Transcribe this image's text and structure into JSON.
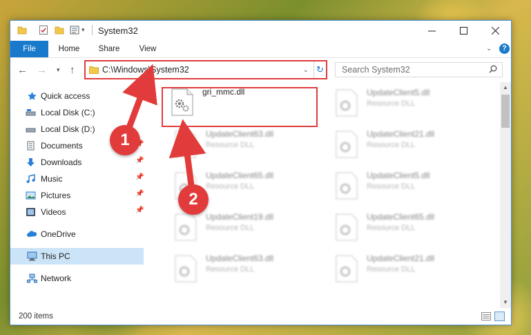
{
  "window": {
    "title": "System32"
  },
  "ribbon": {
    "tabs": [
      "File",
      "Home",
      "Share",
      "View"
    ],
    "help": "?"
  },
  "address_bar": {
    "path": "C:\\Windows\\System32"
  },
  "search": {
    "placeholder": "Search System32"
  },
  "sidebar": {
    "items": [
      {
        "label": "Quick access",
        "icon": "star-icon",
        "pinned": false
      },
      {
        "label": "Local Disk (C:)",
        "icon": "drive-icon",
        "pinned": false
      },
      {
        "label": "Local Disk (D:)",
        "icon": "drive-icon",
        "pinned": false
      },
      {
        "label": "Documents",
        "icon": "documents-icon",
        "pinned": true
      },
      {
        "label": "Downloads",
        "icon": "download-icon",
        "pinned": true
      },
      {
        "label": "Music",
        "icon": "music-icon",
        "pinned": true
      },
      {
        "label": "Pictures",
        "icon": "pictures-icon",
        "pinned": true
      },
      {
        "label": "Videos",
        "icon": "videos-icon",
        "pinned": true
      },
      {
        "label": "OneDrive",
        "icon": "onedrive-icon",
        "pinned": false
      },
      {
        "label": "This PC",
        "icon": "computer-icon",
        "selected": true
      },
      {
        "label": "Network",
        "icon": "network-icon",
        "pinned": false
      }
    ]
  },
  "files": {
    "highlighted": {
      "name": "gri_mmc.dll"
    },
    "left_column": [
      {
        "name": "UpdateClient63.dll",
        "type": "Resource DLL"
      },
      {
        "name": "UpdateClient65.dll",
        "type": "Resource DLL"
      },
      {
        "name": "UpdateClient19.dll",
        "type": "Resource DLL"
      },
      {
        "name": "UpdateClient63.dll",
        "type": "Resource DLL"
      }
    ],
    "right_column": [
      {
        "name": "UpdateClient5.dll",
        "type": "Resource DLL"
      },
      {
        "name": "UpdateClient21.dll",
        "type": "Resource DLL"
      },
      {
        "name": "UpdateClient5.dll",
        "type": "Resource DLL"
      },
      {
        "name": "UpdateClient65.dll",
        "type": "Resource DLL"
      },
      {
        "name": "UpdateClient21.dll",
        "type": "Resource DLL"
      }
    ]
  },
  "status": {
    "item_count": "200 items"
  },
  "callouts": [
    "1",
    "2"
  ],
  "colors": {
    "accent": "#1979ca",
    "highlight": "#e03b3b",
    "selected": "#cce4f7"
  }
}
